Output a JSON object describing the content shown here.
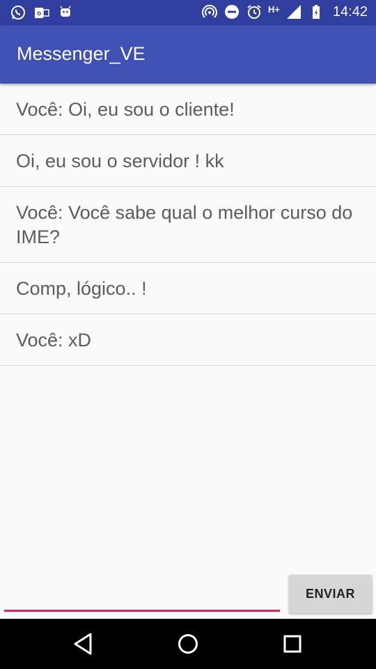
{
  "status_bar": {
    "left_icons": [
      "whatsapp-icon",
      "outlook-icon",
      "android-icon"
    ],
    "right_icons": [
      "hotspot-icon",
      "do-not-disturb-icon",
      "alarm-icon",
      "signal-icon",
      "battery-icon"
    ],
    "network": "H+",
    "time": "14:42"
  },
  "app_bar": {
    "title": "Messenger_VE",
    "color": "#3f51b5"
  },
  "messages": [
    "Você: Oi, eu sou o cliente!",
    "Oi, eu sou o servidor ! kk",
    "Você: Você sabe qual o melhor curso do IME?",
    "Comp, lógico.. !",
    "Você: xD"
  ],
  "composer": {
    "input_value": "",
    "send_label": "ENVIAR",
    "accent": "#e91e63"
  },
  "nav_bar": {
    "icons": [
      "back-icon",
      "home-icon",
      "recents-icon"
    ]
  }
}
